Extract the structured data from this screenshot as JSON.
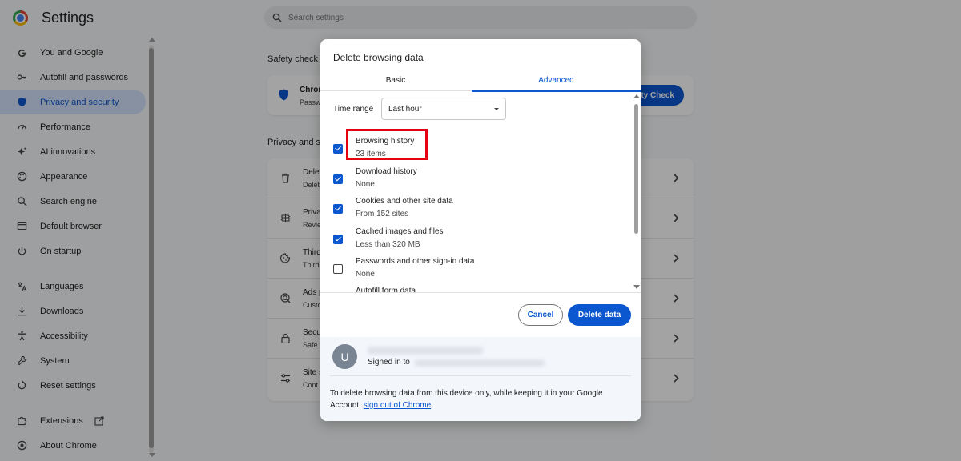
{
  "app": {
    "title": "Settings"
  },
  "search": {
    "placeholder": "Search settings"
  },
  "sidebar": {
    "items": [
      {
        "label": "You and Google"
      },
      {
        "label": "Autofill and passwords"
      },
      {
        "label": "Privacy and security",
        "active": true
      },
      {
        "label": "Performance"
      },
      {
        "label": "AI innovations"
      },
      {
        "label": "Appearance"
      },
      {
        "label": "Search engine"
      },
      {
        "label": "Default browser"
      },
      {
        "label": "On startup"
      },
      {
        "label": "Languages"
      },
      {
        "label": "Downloads"
      },
      {
        "label": "Accessibility"
      },
      {
        "label": "System"
      },
      {
        "label": "Reset settings"
      },
      {
        "label": "Extensions"
      },
      {
        "label": "About Chrome"
      }
    ]
  },
  "background": {
    "safety_check_heading": "Safety check",
    "safety_check_title": "Chron",
    "safety_check_sub": "Passw",
    "safety_check_button": "ty Check",
    "privacy_heading": "Privacy and s",
    "privacy_rows": [
      {
        "title": "Delet",
        "sub": "Delet"
      },
      {
        "title": "Priva",
        "sub": "Revie"
      },
      {
        "title": "Third",
        "sub": "Third"
      },
      {
        "title": "Ads p",
        "sub": "Custo"
      },
      {
        "title": "Secu",
        "sub": "Safe"
      },
      {
        "title": "Site s",
        "sub": "Cont"
      }
    ]
  },
  "dialog": {
    "title": "Delete browsing data",
    "tabs": {
      "basic": "Basic",
      "advanced": "Advanced"
    },
    "time_range_label": "Time range",
    "time_range_value": "Last hour",
    "options": [
      {
        "title": "Browsing history",
        "sub": "23 items",
        "checked": true
      },
      {
        "title": "Download history",
        "sub": "None",
        "checked": true
      },
      {
        "title": "Cookies and other site data",
        "sub": "From 152 sites",
        "checked": true
      },
      {
        "title": "Cached images and files",
        "sub": "Less than 320 MB",
        "checked": true
      },
      {
        "title": "Passwords and other sign-in data",
        "sub": "None",
        "checked": false
      },
      {
        "title": "Autofill form data",
        "sub": "",
        "checked": false
      }
    ],
    "cancel_label": "Cancel",
    "delete_label": "Delete data",
    "account": {
      "avatar_letter": "U",
      "signed_in_label": "Signed in to",
      "note_text": "To delete browsing data from this device only, while keeping it in your Google Account,",
      "note_link": "sign out of Chrome",
      "note_end": "."
    }
  },
  "colors": {
    "accent": "#0b57d0",
    "active_nav_bg": "#d3e3fd",
    "highlight": "#e50012"
  }
}
